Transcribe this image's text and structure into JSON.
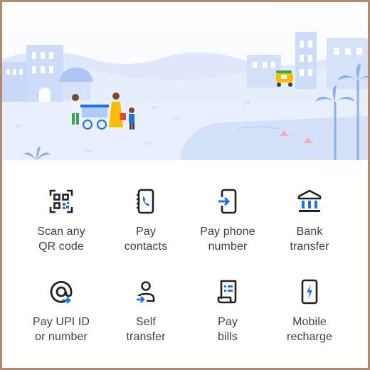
{
  "actions": [
    {
      "line1": "Scan any",
      "line2": "QR code",
      "icon": "qr-scan-icon"
    },
    {
      "line1": "Pay",
      "line2": "contacts",
      "icon": "contacts-phone-icon"
    },
    {
      "line1": "Pay phone",
      "line2": "number",
      "icon": "phone-transfer-icon"
    },
    {
      "line1": "Bank",
      "line2": "transfer",
      "icon": "bank-icon"
    },
    {
      "line1": "Pay UPI ID",
      "line2": "or number",
      "icon": "at-sign-icon"
    },
    {
      "line1": "Self",
      "line2": "transfer",
      "icon": "self-transfer-icon"
    },
    {
      "line1": "Pay",
      "line2": "bills",
      "icon": "bill-icon"
    },
    {
      "line1": "Mobile",
      "line2": "recharge",
      "icon": "mobile-recharge-icon"
    }
  ],
  "colors": {
    "icon_dark": "#202124",
    "icon_blue": "#1a73e8",
    "text": "#3c4043",
    "frame": "#b5896a"
  }
}
